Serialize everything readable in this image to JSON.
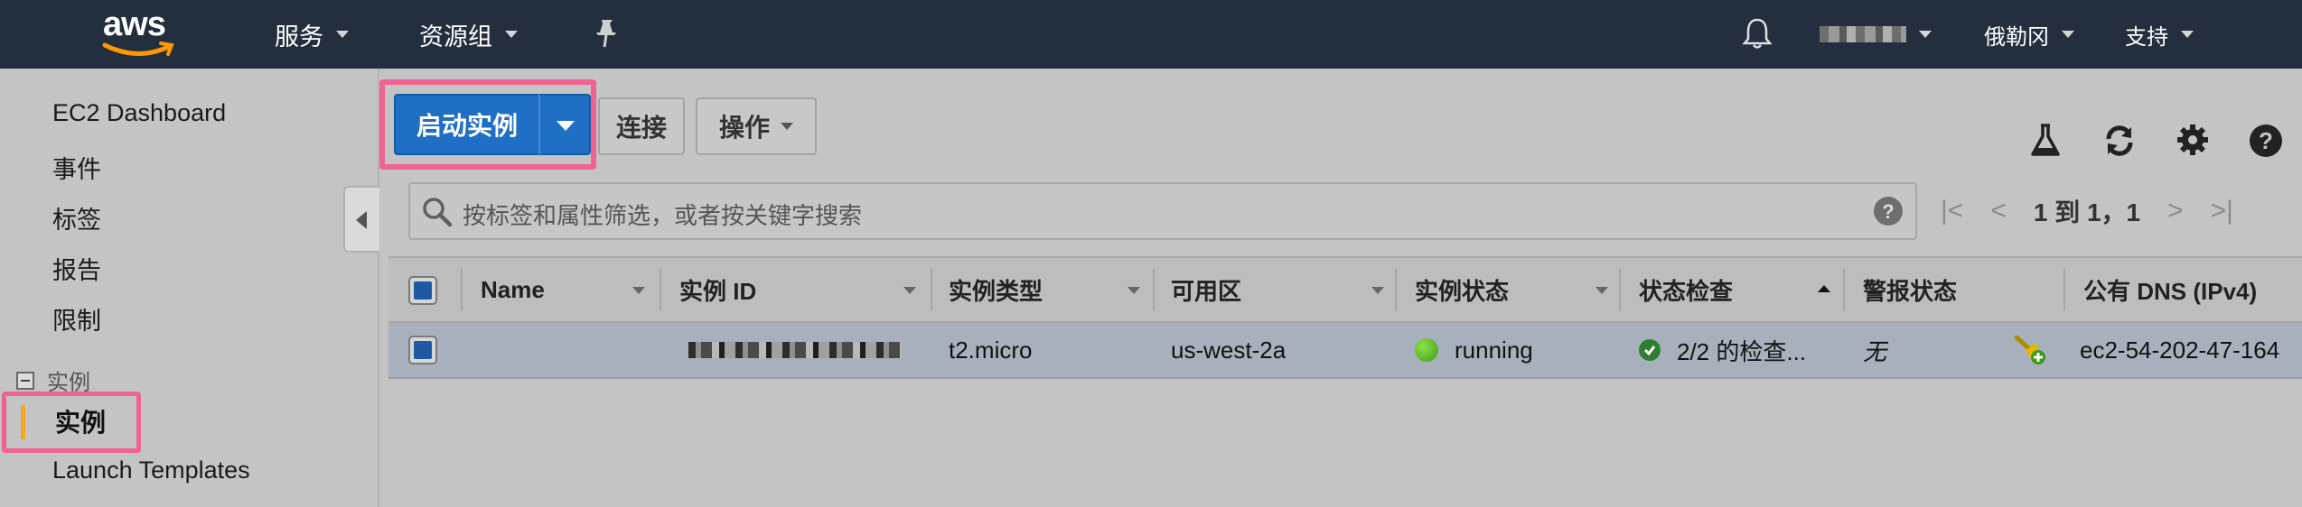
{
  "nav": {
    "logo": "aws",
    "services": "服务",
    "resource_groups": "资源组",
    "region": "俄勒冈",
    "support": "支持"
  },
  "sidebar": {
    "items": [
      {
        "label": "EC2 Dashboard"
      },
      {
        "label": "事件"
      },
      {
        "label": "标签"
      },
      {
        "label": "报告"
      },
      {
        "label": "限制"
      }
    ],
    "group_label": "实例",
    "active_label": "实例",
    "after_items": [
      {
        "label": "Launch Templates"
      }
    ]
  },
  "toolbar": {
    "launch_label": "启动实例",
    "connect_label": "连接",
    "actions_label": "操作"
  },
  "search": {
    "placeholder": "按标签和属性筛选，或者按关键字搜索"
  },
  "pager": {
    "text": "1 到 1，1"
  },
  "table": {
    "columns": [
      "Name",
      "实例 ID",
      "实例类型",
      "可用区",
      "实例状态",
      "状态检查",
      "警报状态",
      "公有 DNS (IPv4)"
    ],
    "rows": [
      {
        "name": "",
        "instance_type": "t2.micro",
        "zone": "us-west-2a",
        "state": "running",
        "status_check": "2/2 的检查...",
        "alarm_status": "无",
        "public_dns": "ec2-54-202-47-164"
      }
    ]
  },
  "colors": {
    "nav_bg": "#232f3e",
    "accent_blue": "#1f6fc5",
    "highlight_pink": "#f06292",
    "active_orange": "#f5a623",
    "running_green": "#3d9a14"
  }
}
